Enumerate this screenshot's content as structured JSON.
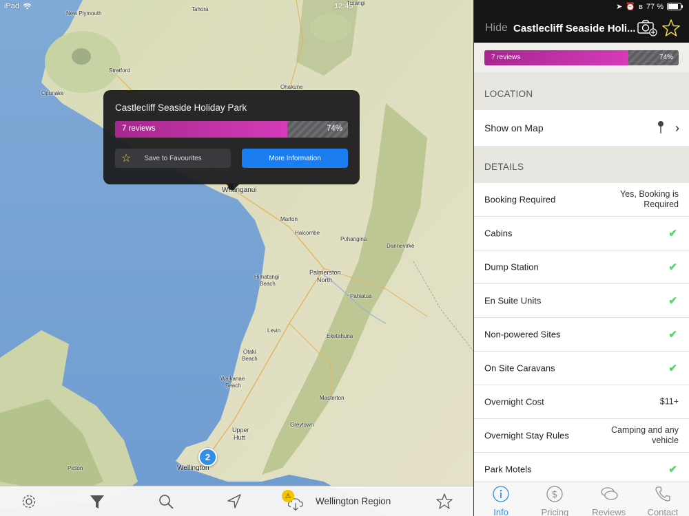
{
  "status_bar": {
    "device": "iPad",
    "time": "12:45",
    "battery": "77 %"
  },
  "map": {
    "places": [
      {
        "name": "New Plymouth",
        "cls": "big"
      },
      {
        "name": "Tahora",
        "cls": ""
      },
      {
        "name": "Turangi",
        "cls": ""
      },
      {
        "name": "Stratford",
        "cls": ""
      },
      {
        "name": "Opunake",
        "cls": ""
      },
      {
        "name": "Ohakune",
        "cls": ""
      },
      {
        "name": "Whanganui",
        "cls": "city"
      },
      {
        "name": "Marton",
        "cls": ""
      },
      {
        "name": "Halcombe",
        "cls": ""
      },
      {
        "name": "Pohangina",
        "cls": ""
      },
      {
        "name": "Dannevirke",
        "cls": ""
      },
      {
        "name": "Palmerston",
        "cls": "big"
      },
      {
        "name": "North",
        "cls": "big"
      },
      {
        "name": "Himatangi",
        "cls": ""
      },
      {
        "name": "Beach",
        "cls": ""
      },
      {
        "name": "Pahiatua",
        "cls": ""
      },
      {
        "name": "Levin",
        "cls": ""
      },
      {
        "name": "Eketahuna",
        "cls": ""
      },
      {
        "name": "Otaki",
        "cls": ""
      },
      {
        "name": "Beach",
        "cls": ""
      },
      {
        "name": "Waikanae",
        "cls": ""
      },
      {
        "name": "Beach",
        "cls": ""
      },
      {
        "name": "Masterton",
        "cls": ""
      },
      {
        "name": "Upper",
        "cls": "big"
      },
      {
        "name": "Hutt",
        "cls": "big"
      },
      {
        "name": "Greytown",
        "cls": ""
      },
      {
        "name": "Wellington",
        "cls": "city"
      },
      {
        "name": "Picton",
        "cls": ""
      }
    ],
    "cluster_count": "2"
  },
  "popup": {
    "title": "Castlecliff Seaside Holiday Park",
    "reviews": "7 reviews",
    "rating_percent": "74%",
    "rating_fraction": 0.74,
    "save_label": "Save to Favourites",
    "more_label": "More Information"
  },
  "toolbar": {
    "region": "Wellington Region",
    "icons": [
      "gear-icon",
      "filter-icon",
      "search-icon",
      "location-arrow-icon",
      "cloud-download-icon",
      "star-icon"
    ]
  },
  "panel": {
    "hide_label": "Hide",
    "title": "Castlecliff Seaside Holi...",
    "reviews": "7 reviews",
    "rating_percent": "74%",
    "rating_fraction": 0.74,
    "location_header": "LOCATION",
    "show_on_map": "Show on Map",
    "details_header": "DETAILS",
    "details": [
      {
        "key": "Booking Required",
        "value": "Yes, Booking is\nRequired",
        "check": false
      },
      {
        "key": "Cabins",
        "value": "",
        "check": true
      },
      {
        "key": "Dump Station",
        "value": "",
        "check": true
      },
      {
        "key": "En Suite Units",
        "value": "",
        "check": true
      },
      {
        "key": "Non-powered Sites",
        "value": "",
        "check": true
      },
      {
        "key": "On Site Caravans",
        "value": "",
        "check": true
      },
      {
        "key": "Overnight Cost",
        "value": "$11+",
        "check": false
      },
      {
        "key": "Overnight Stay Rules",
        "value": "Camping and any\nvehicle",
        "check": false
      },
      {
        "key": "Park Motels",
        "value": "",
        "check": true
      }
    ]
  },
  "tabs": [
    {
      "label": "Info",
      "icon": "info-icon",
      "active": true
    },
    {
      "label": "Pricing",
      "icon": "dollar-icon",
      "active": false
    },
    {
      "label": "Reviews",
      "icon": "speech-bubbles-icon",
      "active": false
    },
    {
      "label": "Contact",
      "icon": "phone-icon",
      "active": false
    }
  ],
  "colors": {
    "accent": "#2f8ee6",
    "rating_fill": "#c932aa",
    "check": "#4cd964",
    "popup_bg": "#19191b",
    "more_button": "#1a7df0"
  }
}
